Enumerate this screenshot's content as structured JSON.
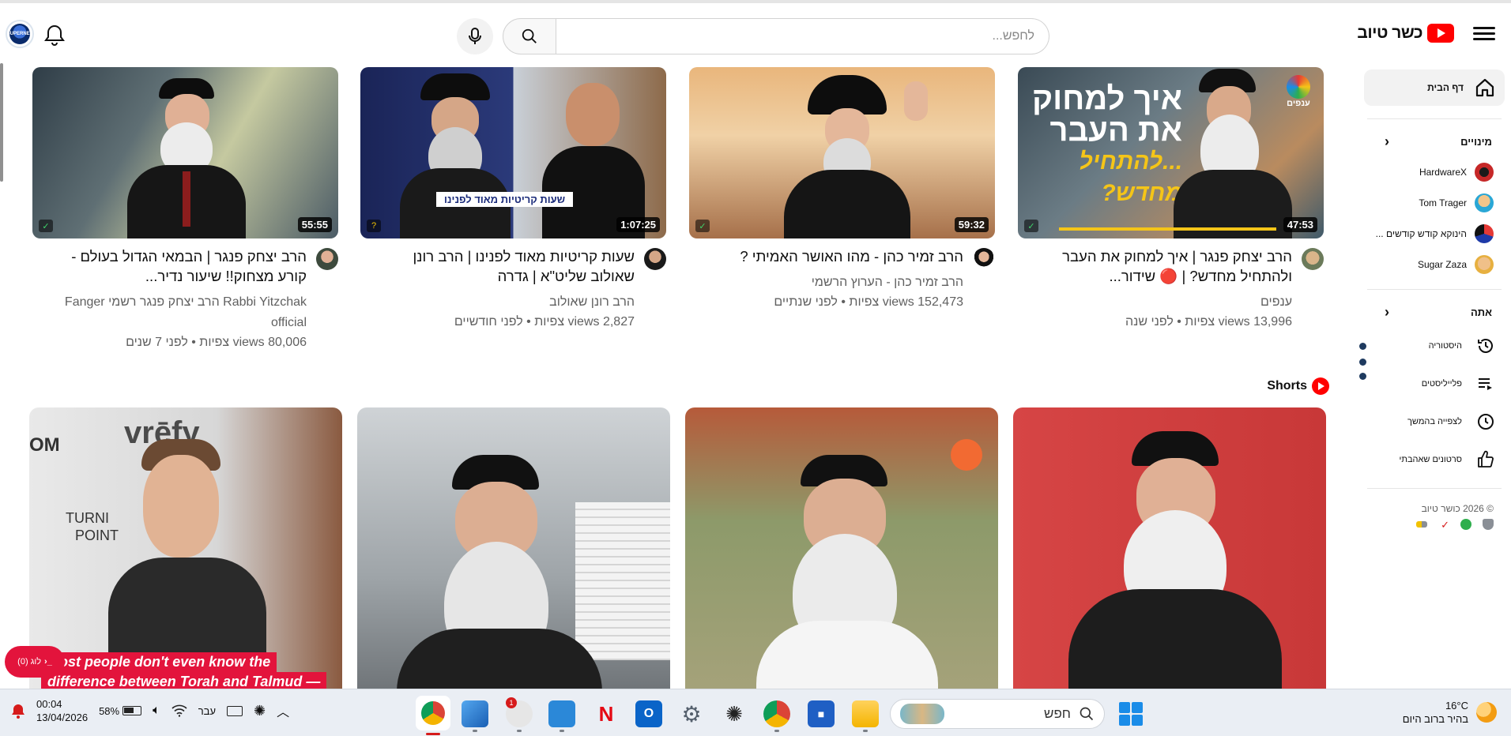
{
  "header": {
    "logo_text": "כשר טיוב",
    "search_placeholder": "לחפש...",
    "mic_icon": "mic-icon",
    "search_icon": "search-icon",
    "bell_icon": "bell-icon",
    "avatar_text": "SUPERNET"
  },
  "sidebar": {
    "home_label": "דף הבית",
    "subscriptions_title": "מינויים",
    "subscriptions": [
      {
        "label": "HardwareX",
        "color": "#c62828"
      },
      {
        "label": "Tom Trager",
        "color": "#f4c542"
      },
      {
        "label": "הינוקא קודש קודשים ...",
        "color": "#2e56c9"
      },
      {
        "label": "Sugar Zaza",
        "color": "#e7c16a"
      }
    ],
    "you_title": "אתה",
    "you_items": [
      {
        "label": "היסטוריה",
        "icon": "history-icon"
      },
      {
        "label": "פלייליסטים",
        "icon": "playlist-icon"
      },
      {
        "label": "לצפייה בהמשך",
        "icon": "clock-icon"
      },
      {
        "label": "סרטונים שאהבתי",
        "icon": "thumbs-up-icon"
      }
    ],
    "footer": "© 2026 כושר טיוב"
  },
  "videos": [
    {
      "title": "הרב יצחק פנגר | איך למחוק את העבר ולהתחיל מחדש? | 🔴 שידור...",
      "channel": "ענפים",
      "stats": "13,996 views צפיות • לפני שנה",
      "duration": "47:53",
      "badge": "check",
      "thumb_text_1": "איך למחוק",
      "thumb_text_2": "את העבר",
      "thumb_text_3": "...להתחיל",
      "thumb_text_4": "מחדש?",
      "thumb_brand": "ענפים"
    },
    {
      "title": "הרב זמיר כהן - מהו האושר האמיתי ?",
      "channel": "הרב זמיר כהן - הערוץ הרשמי",
      "stats": "152,473 views צפיות • לפני שנתיים",
      "duration": "59:32",
      "badge": "check"
    },
    {
      "title": "שעות קריטיות מאוד לפנינו | הרב רונן שאולוב שליט\"א | גדרה",
      "channel": "הרב רונן שאולוב",
      "stats": "2,827 views צפיות • לפני חודשיים",
      "duration": "1:07:25",
      "badge": "question",
      "thumb_caption": "שעות קריטיות מאוד לפנינו"
    },
    {
      "title": "הרב יצחק פנגר | הבמאי הגדול בעולם - קורע מצחוק!! שיעור נדיר...",
      "channel": "Rabbi Yitzchak הרב יצחק פנגר רשמי Fanger official",
      "stats": "80,006 views צפיות • לפני 7 שנים",
      "duration": "55:55",
      "badge": "check"
    }
  ],
  "shorts": {
    "title": "Shorts",
    "caption_line1": "Most people don't even know the",
    "caption_line2": "difference between Torah and Talmud —",
    "sign_text_1": "vrēfy",
    "sign_text_2": "TURNI",
    "sign_text_3": "POINT",
    "sign_text_4": "OM"
  },
  "live_pill": {
    "label": "לוג (0)"
  },
  "taskbar": {
    "weather_temp": "16°C",
    "weather_desc": "בהיר ברוב היום",
    "search_label": "חפש",
    "time": "00:04",
    "date": "13/04/2026",
    "battery": "58%",
    "lang": "עבר"
  }
}
